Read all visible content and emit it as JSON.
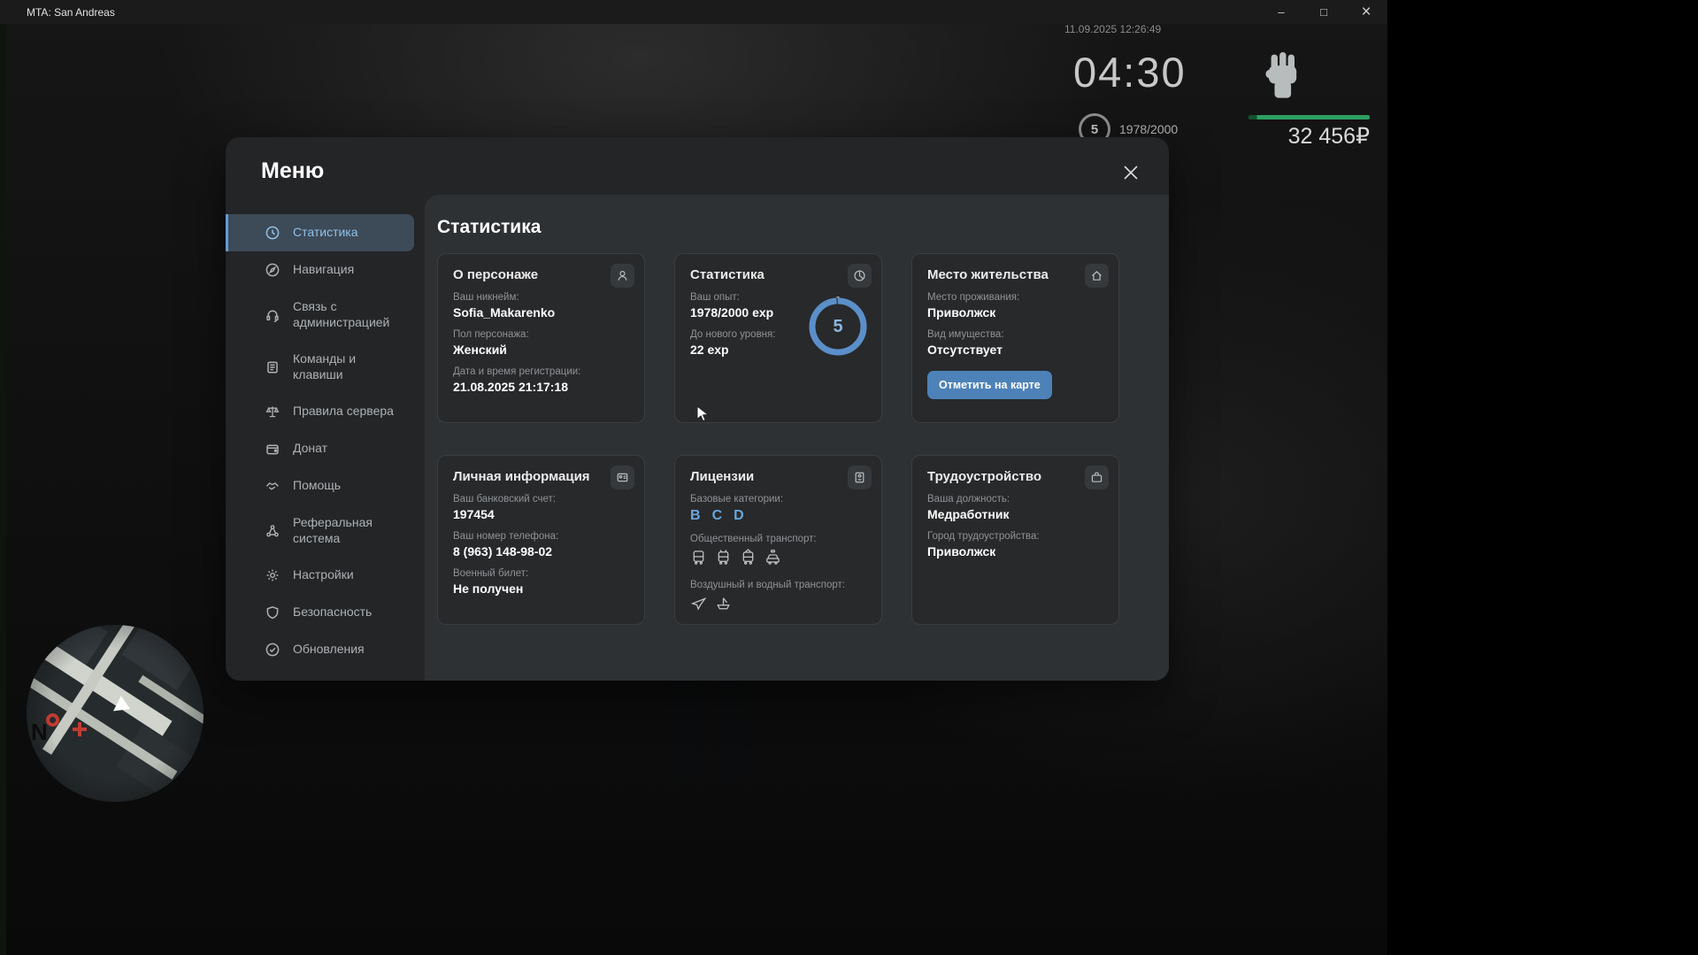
{
  "window": {
    "title": "MTA: San Andreas",
    "minimize": "–",
    "maximize": "□",
    "close": "×"
  },
  "hud": {
    "datetime": "11.09.2025 12:26:49",
    "clock": "04:30",
    "level": "5",
    "exp": "1978/2000",
    "money": "32 456₽",
    "map_marker": "N"
  },
  "menu": {
    "title": "Меню",
    "sidebar": {
      "items": [
        {
          "label": "Статистика",
          "active": true
        },
        {
          "label": "Навигация"
        },
        {
          "label": "Связь с администрацией"
        },
        {
          "label": "Команды и клавиши"
        },
        {
          "label": "Правила сервера"
        },
        {
          "label": "Донат"
        },
        {
          "label": "Помощь"
        },
        {
          "label": "Реферальная система"
        },
        {
          "label": "Настройки"
        },
        {
          "label": "Безопасность"
        },
        {
          "label": "Обновления"
        }
      ]
    },
    "content": {
      "title": "Статистика",
      "cards": {
        "character": {
          "title": "О персонаже",
          "fields": [
            {
              "label": "Ваш никнейм:",
              "value": "Sofia_Makarenko"
            },
            {
              "label": "Пол персонажа:",
              "value": "Женский"
            },
            {
              "label": "Дата и время регистрации:",
              "value": "21.08.2025 21:17:18"
            }
          ]
        },
        "stats": {
          "title": "Статистика",
          "fields": [
            {
              "label": "Ваш опыт:",
              "value": "1978/2000 exp"
            },
            {
              "label": "До нового уровня:",
              "value": "22 exp"
            }
          ],
          "level": "5",
          "progress_percent": 98.9
        },
        "residence": {
          "title": "Место жительства",
          "fields": [
            {
              "label": "Место проживания:",
              "value": "Приволжск"
            },
            {
              "label": "Вид имущества:",
              "value": "Отсутствует"
            }
          ],
          "button": "Отметить на карте"
        },
        "personal": {
          "title": "Личная информация",
          "fields": [
            {
              "label": "Ваш банковский счет:",
              "value": "197454"
            },
            {
              "label": "Ваш номер телефона:",
              "value": "8 (963) 148-98-02"
            },
            {
              "label": "Военный билет:",
              "value": "Не получен"
            }
          ]
        },
        "licenses": {
          "title": "Лицензии",
          "categories_label": "Базовые категории:",
          "categories": [
            "B",
            "C",
            "D"
          ],
          "public_transport_label": "Общественный транспорт:",
          "public_transport_icons": [
            "bus",
            "trolleybus",
            "tram",
            "taxi"
          ],
          "air_water_label": "Воздушный и водный транспорт:",
          "air_water_icons": [
            "plane",
            "ship"
          ]
        },
        "employment": {
          "title": "Трудоустройство",
          "fields": [
            {
              "label": "Ваша должность:",
              "value": "Медработник"
            },
            {
              "label": "Город трудоустройства:",
              "value": "Приволжск"
            }
          ]
        }
      }
    }
  },
  "colors": {
    "accent_blue": "#8fc1e8",
    "button_blue": "#4d82b8",
    "progress_blue": "#5b8fc9",
    "money_green": "#2e9e63"
  }
}
